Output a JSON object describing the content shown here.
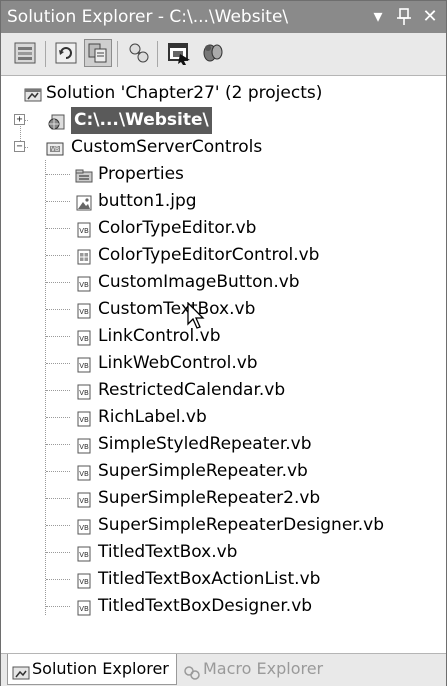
{
  "window": {
    "title": "Solution Explorer - C:\\...\\Website\\",
    "pin_glyph": "Д",
    "close_glyph": "✕",
    "dropdown_glyph": "▾"
  },
  "toolbar": {
    "buttons": [
      "properties-icon",
      "refresh-icon",
      "show-all-files-icon",
      "view-class-diagram-icon",
      "view-code-icon",
      "view-designer-icon"
    ]
  },
  "tree": {
    "solution": "Solution 'Chapter27' (2 projects)",
    "website": "C:\\...\\Website\\",
    "project": "CustomServerControls",
    "items": [
      "Properties",
      "button1.jpg",
      "ColorTypeEditor.vb",
      "ColorTypeEditorControl.vb",
      "CustomImageButton.vb",
      "CustomTextBox.vb",
      "LinkControl.vb",
      "LinkWebControl.vb",
      "RestrictedCalendar.vb",
      "RichLabel.vb",
      "SimpleStyledRepeater.vb",
      "SuperSimpleRepeater.vb",
      "SuperSimpleRepeater2.vb",
      "SuperSimpleRepeaterDesigner.vb",
      "TitledTextBox.vb",
      "TitledTextBoxActionList.vb",
      "TitledTextBoxDesigner.vb"
    ]
  },
  "tabs": {
    "solution_explorer": "Solution Explorer",
    "macro_explorer": "Macro Explorer"
  }
}
